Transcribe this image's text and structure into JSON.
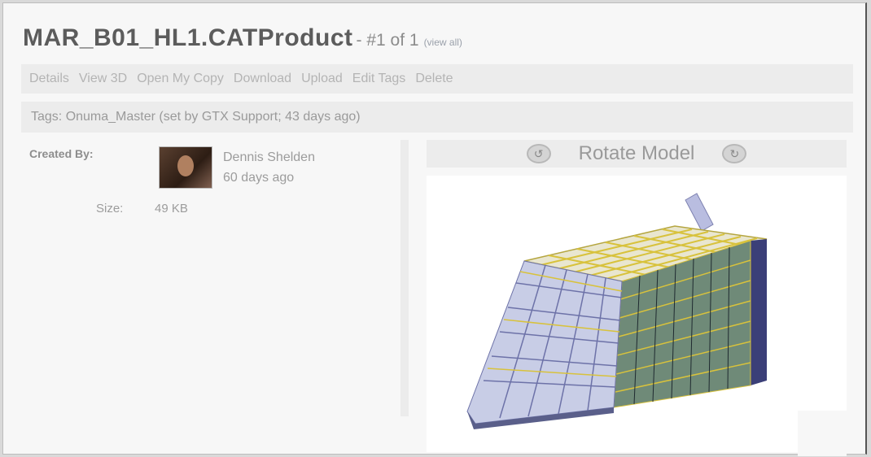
{
  "header": {
    "title": "MAR_B01_HL1.CATProduct",
    "position": "- #1 of 1",
    "view_all": "(view all)"
  },
  "actions": [
    "Details",
    "View 3D",
    "Open My Copy",
    "Download",
    "Upload",
    "Edit Tags",
    "Delete"
  ],
  "tags": {
    "text": "Tags: Onuma_Master (set by GTX Support; 43 days ago)"
  },
  "meta": {
    "created_by_label": "Created By:",
    "creator_name": "Dennis Shelden",
    "created_ago": "60 days ago",
    "size_label": "Size:",
    "size_value": "49 KB"
  },
  "viewer": {
    "rotate_label": "Rotate Model",
    "rotate_left_icon": "rotate-left-icon",
    "rotate_right_icon": "rotate-right-icon"
  },
  "colors": {
    "frame_bg": "#f7f7f7",
    "bar_bg": "#ececec",
    "title": "#5c5c5c",
    "glass_face": "#6f8a78",
    "roof_grid": "#d8c23c",
    "front_facade": "#c8cde6"
  }
}
